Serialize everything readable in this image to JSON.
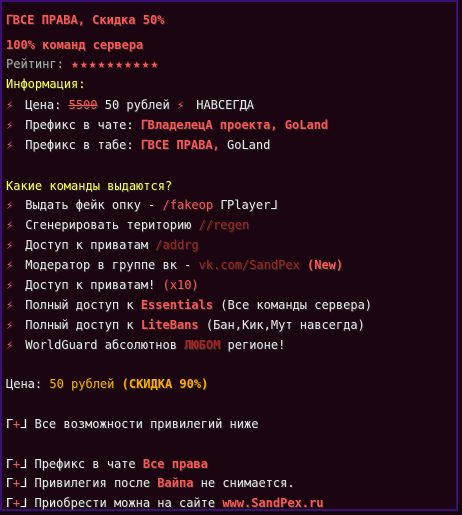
{
  "title": "ᒥВСЕ ПРАВА, Скидка 50%",
  "subtitle": "100% команд сервера",
  "rating": {
    "label": "Рейтинг:",
    "stars": "★★★★★★★★★★"
  },
  "info_header": "Информация:",
  "price_line": {
    "label": "Цена:",
    "old": "5500",
    "new": "50 рублей",
    "bolt2": "⚡",
    "forever": "НАВСЕГДА"
  },
  "prefix_chat": {
    "label": "Префикс в чате:",
    "value": "ᒥВладелецА проекта, GoLand"
  },
  "prefix_tab": {
    "label": "Префикс в табе:",
    "value_red": "ᒥВСЕ ПРАВА,",
    "value_white": " GoLand"
  },
  "commands_header": "Какие команды выдаются?",
  "commands": [
    {
      "text": "Выдать фейк опку - ",
      "cmd": "/fakeop",
      "tail": " ᒥPlayerᒧ"
    },
    {
      "text": "Сгенерировать територию ",
      "cmd": "//regen",
      "tail": ""
    },
    {
      "text": "Доступ к приватам ",
      "cmd": "/addrg",
      "tail": ""
    },
    {
      "text": "Модератор в группе вк - ",
      "cmd": "vk.com/SandPex",
      "tail": " (New)"
    },
    {
      "text": "Доступ к приватам! ",
      "cmd": "(x10)",
      "tail": ""
    },
    {
      "text": "Полный доступ к ",
      "cmd": "Essentials",
      "tail": " (Все команды сервера)"
    },
    {
      "text": "Полный доступ к ",
      "cmd": "LiteBans",
      "tail": " (Бан,Кик,Мут навсегда)"
    },
    {
      "text": "WorldGuard абсолютнов ",
      "cmd": "ЛЮБОМ",
      "tail": " регионе!"
    }
  ],
  "footer_price": {
    "label": "Цена: ",
    "value": "50 рублей",
    "discount": " (СКИДКА 90%)"
  },
  "features": [
    {
      "text": "Все возможности привилегий ниже",
      "red": "",
      "tail": ""
    }
  ],
  "extras": [
    {
      "text": "Префикс в чате ",
      "red": "Все права",
      "tail": ""
    },
    {
      "text": "Привилегия после ",
      "red": "Вайпа",
      "tail": " не снимается."
    },
    {
      "text": "Приобрести можна на сайте ",
      "red": "www.SandPex.ru",
      "tail": ""
    }
  ],
  "glyphs": {
    "bolt": "⚡",
    "corner": "ᒥ",
    "plus": "+"
  },
  "colors": {
    "red": "#ff5555",
    "gold": "#ffaa00",
    "yellow": "#ffff55",
    "border": "#3a0f7a",
    "bg": "#1a0510"
  }
}
